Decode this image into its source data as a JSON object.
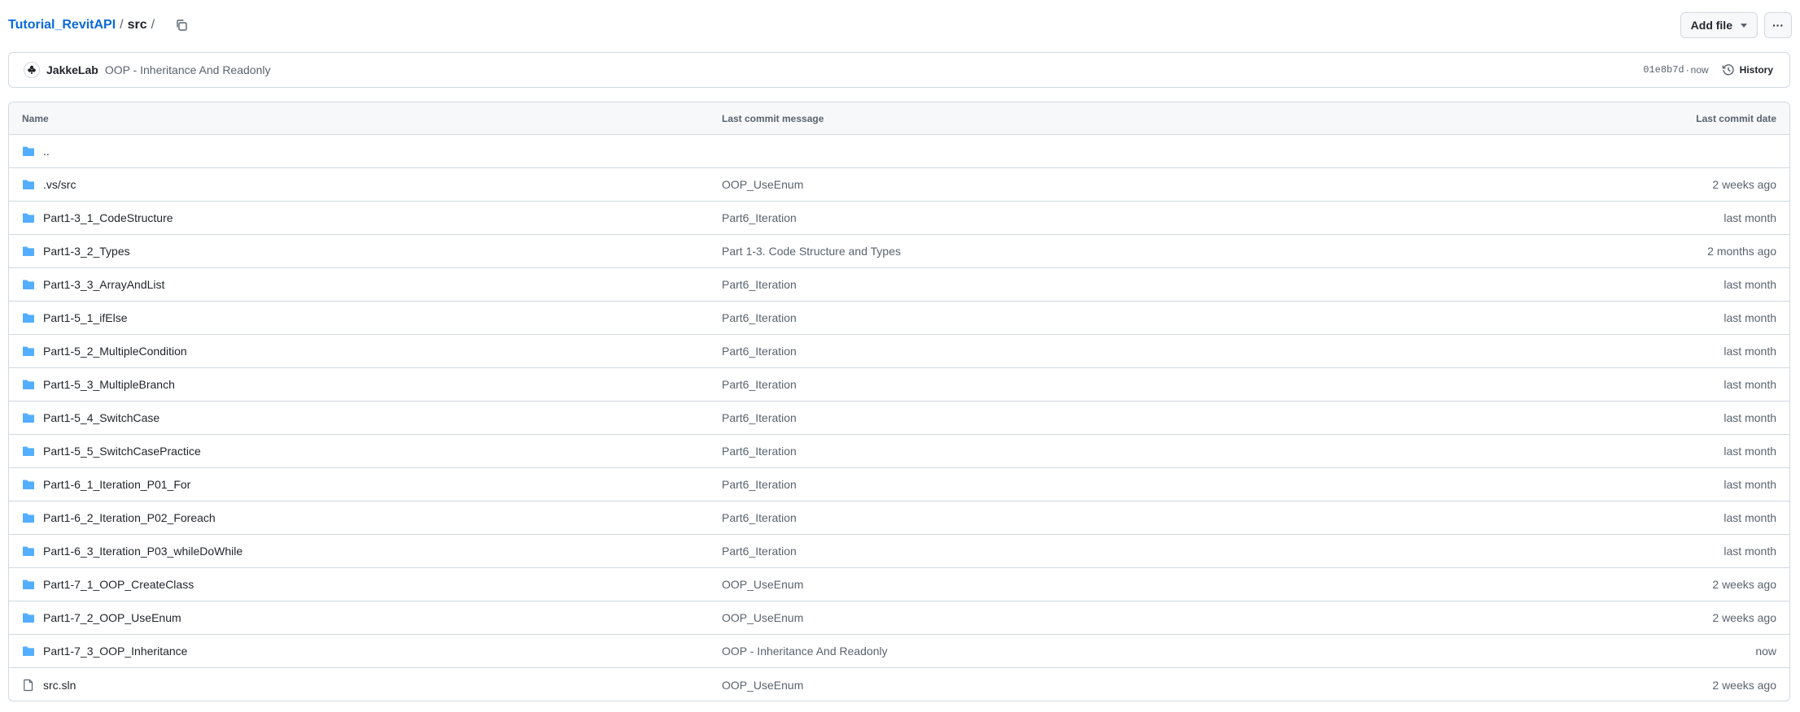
{
  "breadcrumb": {
    "repo": "Tutorial_RevitAPI",
    "sep1": "/",
    "dir": "src",
    "sep2": "/"
  },
  "actions": {
    "add_file": "Add file",
    "more": "···"
  },
  "latest_commit": {
    "author": "JakkeLab",
    "message": "OOP - Inheritance And Readonly",
    "sha": "01e8b7d",
    "dot": "·",
    "time": "now",
    "history_label": "History"
  },
  "table": {
    "headers": {
      "name": "Name",
      "message": "Last commit message",
      "date": "Last commit date"
    },
    "rows": [
      {
        "type": "folder",
        "name": "..",
        "message": "",
        "date": ""
      },
      {
        "type": "folder",
        "name": ".vs/src",
        "message": "OOP_UseEnum",
        "date": "2 weeks ago"
      },
      {
        "type": "folder",
        "name": "Part1-3_1_CodeStructure",
        "message": "Part6_Iteration",
        "date": "last month"
      },
      {
        "type": "folder",
        "name": "Part1-3_2_Types",
        "message": "Part 1-3. Code Structure and Types",
        "date": "2 months ago"
      },
      {
        "type": "folder",
        "name": "Part1-3_3_ArrayAndList",
        "message": "Part6_Iteration",
        "date": "last month"
      },
      {
        "type": "folder",
        "name": "Part1-5_1_ifElse",
        "message": "Part6_Iteration",
        "date": "last month"
      },
      {
        "type": "folder",
        "name": "Part1-5_2_MultipleCondition",
        "message": "Part6_Iteration",
        "date": "last month"
      },
      {
        "type": "folder",
        "name": "Part1-5_3_MultipleBranch",
        "message": "Part6_Iteration",
        "date": "last month"
      },
      {
        "type": "folder",
        "name": "Part1-5_4_SwitchCase",
        "message": "Part6_Iteration",
        "date": "last month"
      },
      {
        "type": "folder",
        "name": "Part1-5_5_SwitchCasePractice",
        "message": "Part6_Iteration",
        "date": "last month"
      },
      {
        "type": "folder",
        "name": "Part1-6_1_Iteration_P01_For",
        "message": "Part6_Iteration",
        "date": "last month"
      },
      {
        "type": "folder",
        "name": "Part1-6_2_Iteration_P02_Foreach",
        "message": "Part6_Iteration",
        "date": "last month"
      },
      {
        "type": "folder",
        "name": "Part1-6_3_Iteration_P03_whileDoWhile",
        "message": "Part6_Iteration",
        "date": "last month"
      },
      {
        "type": "folder",
        "name": "Part1-7_1_OOP_CreateClass",
        "message": "OOP_UseEnum",
        "date": "2 weeks ago"
      },
      {
        "type": "folder",
        "name": "Part1-7_2_OOP_UseEnum",
        "message": "OOP_UseEnum",
        "date": "2 weeks ago"
      },
      {
        "type": "folder",
        "name": "Part1-7_3_OOP_Inheritance",
        "message": "OOP - Inheritance And Readonly",
        "date": "now"
      },
      {
        "type": "file",
        "name": "src.sln",
        "message": "OOP_UseEnum",
        "date": "2 weeks ago"
      }
    ]
  },
  "colors": {
    "link": "#0969da",
    "folder": "#54aeff",
    "muted": "#59636e",
    "border": "#d1d9e0"
  },
  "icons": {
    "copy": "copy-icon",
    "folder": "folder-icon",
    "file": "file-icon",
    "history": "history-icon",
    "avatar": "avatar-icon"
  }
}
